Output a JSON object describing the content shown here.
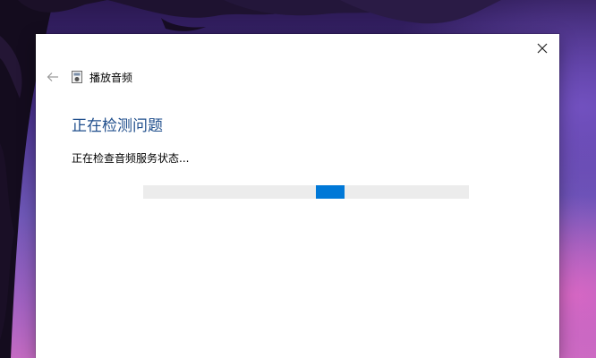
{
  "window": {
    "title": "播放音频",
    "close_icon": "close-icon",
    "back_icon": "back-arrow-icon",
    "app_icon": "audio-troubleshooter-icon"
  },
  "content": {
    "heading": "正在检测问题",
    "status": "正在检查音频服务状态...",
    "progress": {
      "mode": "indeterminate",
      "position_fraction": 0.53,
      "accent": "#0078d7",
      "track": "#ececec"
    }
  },
  "colors": {
    "heading": "#1f4e8c",
    "window_bg": "#ffffff"
  }
}
